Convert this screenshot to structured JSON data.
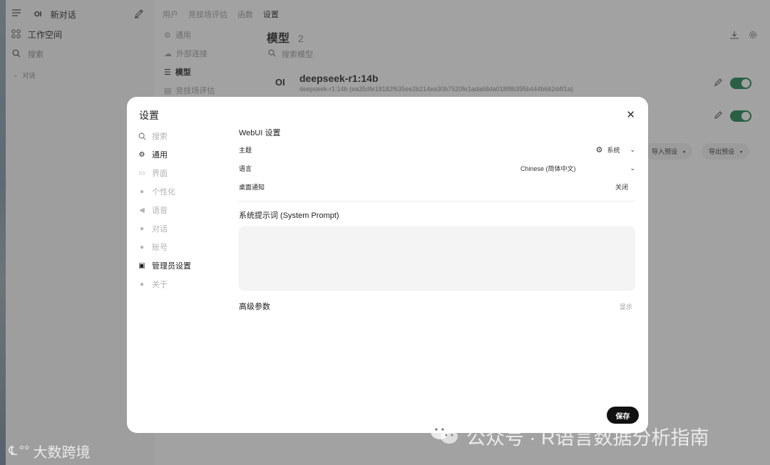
{
  "sidebar": {
    "new_chat_logo": "OI",
    "new_chat_label": "新对话",
    "workspace_label": "工作空间",
    "search_placeholder": "搜索",
    "chats_section": "对话"
  },
  "topnav": {
    "items": [
      "用户",
      "竞技场评估",
      "函数",
      "设置"
    ],
    "active": "设置"
  },
  "subnav": {
    "items": [
      "通用",
      "外部连接",
      "模型",
      "竞技场评估"
    ],
    "active": "模型"
  },
  "models": {
    "title": "模型",
    "count": "2",
    "search_placeholder": "搜索模型",
    "rows": [
      {
        "logo": "OI",
        "name": "deepseek-r1:14b",
        "id": "deepseek-r1:14b (ea35dfe18182f635ee2b214ea30b7520fe1ada68da018f8b395b444b662d4f1a)",
        "enabled": true
      },
      {
        "enabled": true
      }
    ],
    "import_preset": "导入预设",
    "export_preset": "导出预设"
  },
  "modal": {
    "title": "设置",
    "close_icon": "close-icon",
    "nav": [
      {
        "label": "搜索",
        "icon": "search-icon"
      },
      {
        "label": "通用",
        "icon": "gear-icon"
      },
      {
        "label": "界面",
        "icon": "monitor-icon"
      },
      {
        "label": "个性化",
        "icon": "user-icon"
      },
      {
        "label": "语音",
        "icon": "speaker-icon"
      },
      {
        "label": "对话",
        "icon": "chat-icon"
      },
      {
        "label": "账号",
        "icon": "account-icon"
      },
      {
        "label": "管理员设置",
        "icon": "admin-icon"
      },
      {
        "label": "关于",
        "icon": "info-icon"
      }
    ],
    "webui_header": "WebUI 设置",
    "theme_label": "主题",
    "theme_value": "系统",
    "language_label": "语言",
    "language_value": "Chinese (简体中文)",
    "notification_label": "桌面通知",
    "notification_value": "关闭",
    "system_prompt_label": "系统提示词 (System Prompt)",
    "system_prompt_value": "",
    "advanced_label": "高级参数",
    "advanced_toggle": "显示",
    "save_label": "保存"
  },
  "watermark": {
    "right": "公众号 · R语言数据分析指南",
    "left": "大数跨境"
  }
}
